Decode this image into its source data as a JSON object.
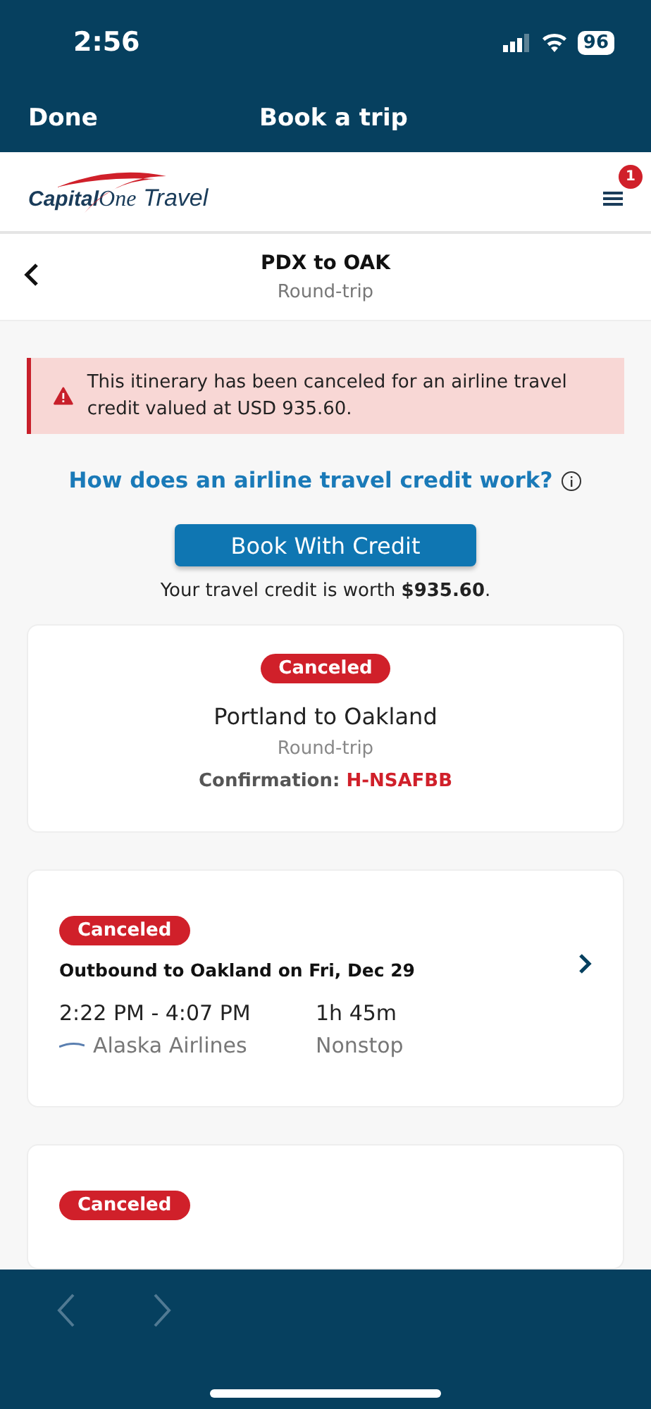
{
  "status_bar": {
    "time": "2:56",
    "battery": "96"
  },
  "nav": {
    "done": "Done",
    "title": "Book a trip"
  },
  "brand": {
    "word_1": "Capital",
    "word_2": "One",
    "product": "Travel",
    "menu_badge": "1"
  },
  "header": {
    "title": "PDX to OAK",
    "subtitle": "Round-trip"
  },
  "alert": {
    "kind": "error",
    "text": "This itinerary has been canceled for an airline travel credit valued at USD 935.60."
  },
  "help_link": "How does an airline travel credit work?",
  "primary_button": "Book With Credit",
  "credit_note": "Your travel credit is worth **$935.60**.",
  "trip_card": {
    "status": "Canceled",
    "title": "Portland to Oakland",
    "subtitle": "Round-trip",
    "confirmation_label": "Confirmation:",
    "confirmation_code": "H-NSAFBB"
  },
  "segments": [
    {
      "status": "Canceled",
      "title": "Outbound to Oakland on Fri, Dec 29",
      "times": "2:22 PM - 4:07 PM",
      "duration": "1h 45m",
      "airline": "Alaska Airlines",
      "stops": "Nonstop"
    },
    {
      "status": "Canceled"
    }
  ],
  "browser_toolbar": {
    "back_disabled": true,
    "forward_disabled": true
  }
}
